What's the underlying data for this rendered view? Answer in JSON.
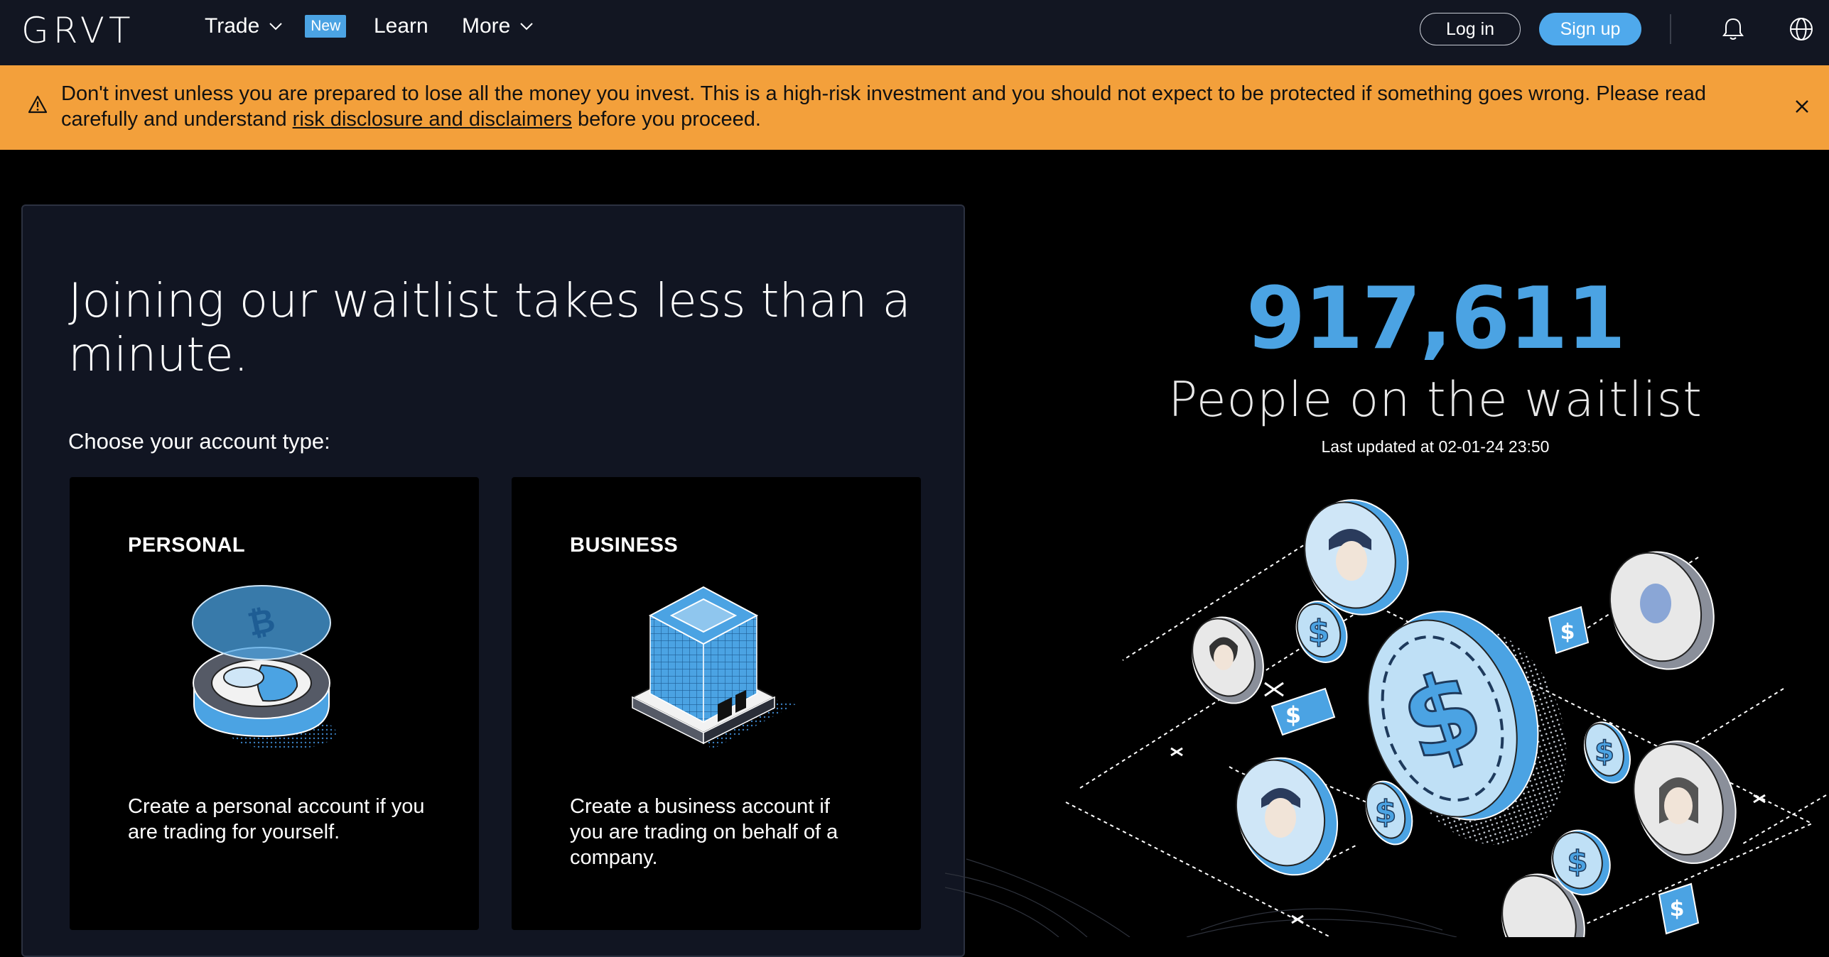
{
  "nav": {
    "logo": "GRVT",
    "trade_label": "Trade",
    "new_badge": "New",
    "learn_label": "Learn",
    "more_label": "More",
    "login_label": "Log in",
    "signup_label": "Sign up"
  },
  "banner": {
    "text_before": "Don't invest unless you are prepared to lose all the money you invest. This is a high-risk investment and you should not expect to be protected if something goes wrong. Please read carefully and understand ",
    "link_text": "risk disclosure and disclaimers",
    "text_after": " before you proceed."
  },
  "card": {
    "title": "Joining our waitlist takes less than a minute.",
    "subtitle": "Choose your account type:",
    "personal": {
      "label": "PERSONAL",
      "description": "Create a personal account if you are trading for yourself."
    },
    "business": {
      "label": "BUSINESS",
      "description": "Create a business account if you are trading on behalf of a company."
    }
  },
  "stats": {
    "count": "917,611",
    "label": "People on the waitlist",
    "updated": "Last updated at 02-01-24 23:50"
  },
  "colors": {
    "accent": "#4ba3e3",
    "banner": "#f3a03b",
    "nav_bg": "#121622",
    "card_bg": "#111522"
  }
}
